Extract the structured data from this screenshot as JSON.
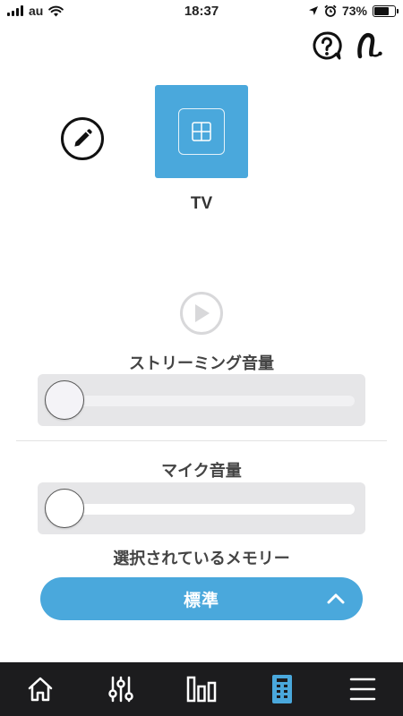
{
  "status_bar": {
    "carrier": "au",
    "time": "18:37",
    "battery_percent": "73%",
    "battery_level": 0.73,
    "icons": [
      "signal-icon",
      "wifi-icon",
      "location-icon",
      "alarm-icon",
      "battery-icon"
    ]
  },
  "header": {
    "icons": [
      "help-icon",
      "hearing-aid-icon"
    ]
  },
  "program": {
    "title": "TV",
    "tile_icon": "grid-icon",
    "edit_icon": "pencil-icon"
  },
  "streaming": {
    "label": "ストリーミング音量",
    "value": 0
  },
  "mic": {
    "label": "マイク音量",
    "value": 0
  },
  "memory": {
    "label": "選択されているメモリー",
    "selected": "標準",
    "icon": "chevron-up-icon"
  },
  "bottom_nav": {
    "items": [
      {
        "icon": "home-icon"
      },
      {
        "icon": "sliders-icon"
      },
      {
        "icon": "bar-chart-icon"
      },
      {
        "icon": "remote-icon",
        "active": true
      },
      {
        "icon": "menu-icon"
      }
    ],
    "active_color": "#4aa8dc"
  },
  "colors": {
    "accent": "#4aa8dc",
    "nav_bg": "#1c1c1e"
  }
}
